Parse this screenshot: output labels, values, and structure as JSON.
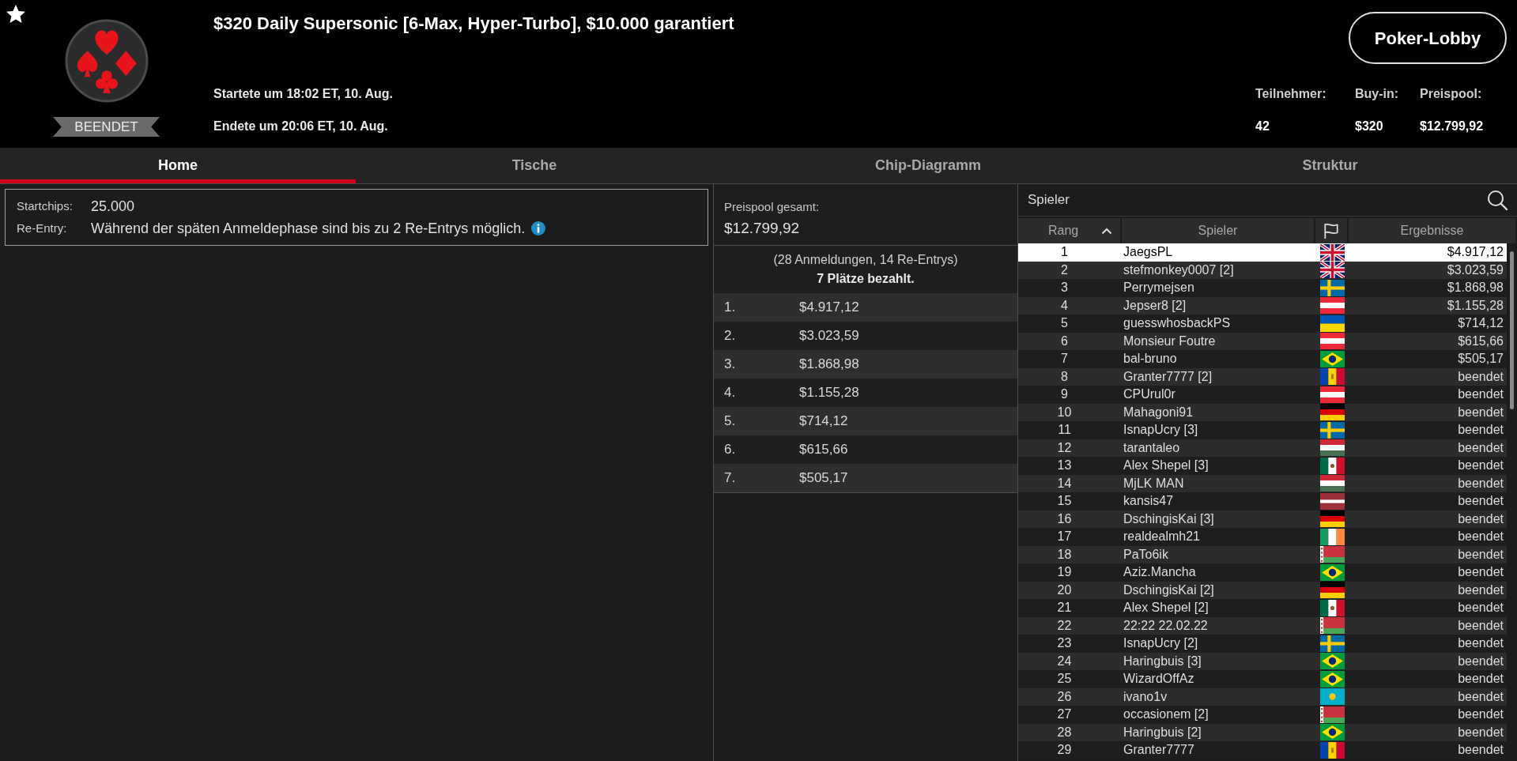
{
  "header": {
    "status": "BEENDET",
    "title": "$320 Daily Supersonic [6-Max, Hyper-Turbo], $10.000 garantiert",
    "started": "Startete um 18:02 ET, 10. Aug.",
    "ended": "Endete um 20:06 ET, 10. Aug.",
    "lobby_button": "Poker-Lobby",
    "stats": [
      {
        "label": "Teilnehmer:",
        "value": "42"
      },
      {
        "label": "Buy-in:",
        "value": "$320"
      },
      {
        "label": "Preispool:",
        "value": "$12.799,92"
      }
    ]
  },
  "tabs": [
    {
      "label": "Home",
      "selected": true
    },
    {
      "label": "Tische",
      "selected": false
    },
    {
      "label": "Chip-Diagramm",
      "selected": false
    },
    {
      "label": "Struktur",
      "selected": false
    }
  ],
  "info_rows": [
    {
      "label": "Startchips:",
      "value": "25.000",
      "info": false
    },
    {
      "label": "Re-Entry:",
      "value": "Während der späten Anmeldephase sind bis zu 2 Re-Entrys möglich.",
      "info": true
    }
  ],
  "prize_pool": {
    "label": "Preispool gesamt:",
    "total": "$12.799,92",
    "entries": "(28 Anmeldungen, 14 Re-Entrys)",
    "paid": "7 Plätze bezahlt.",
    "payouts": [
      {
        "place": "1.",
        "amount": "$4.917,12"
      },
      {
        "place": "2.",
        "amount": "$3.023,59"
      },
      {
        "place": "3.",
        "amount": "$1.868,98"
      },
      {
        "place": "4.",
        "amount": "$1.155,28"
      },
      {
        "place": "5.",
        "amount": "$714,12"
      },
      {
        "place": "6.",
        "amount": "$615,66"
      },
      {
        "place": "7.",
        "amount": "$505,17"
      }
    ]
  },
  "players": {
    "title": "Spieler",
    "columns": [
      {
        "kind": "text",
        "label": "Rang",
        "sorted": true
      },
      {
        "kind": "text",
        "label": "Spieler",
        "sorted": false
      },
      {
        "kind": "flag",
        "sorted": false
      },
      {
        "kind": "text",
        "label": "Ergebnisse",
        "sorted": false
      }
    ],
    "rows": [
      {
        "rank": "1",
        "name": "JaegsPL",
        "kind": "gb",
        "result": "$4.917,12",
        "selected": true
      },
      {
        "rank": "2",
        "name": "stefmonkey0007 [2]",
        "kind": "gb",
        "result": "$3.023,59",
        "selected": false
      },
      {
        "rank": "3",
        "name": "Perrymejsen",
        "kind": "se",
        "result": "$1.868,98",
        "selected": false
      },
      {
        "rank": "4",
        "name": "Jepser8 [2]",
        "kind": "at",
        "result": "$1.155,28",
        "selected": false
      },
      {
        "rank": "5",
        "name": "guesswhosbackPS",
        "kind": "ua",
        "result": "$714,12",
        "selected": false
      },
      {
        "rank": "6",
        "name": "Monsieur Foutre",
        "kind": "at",
        "result": "$615,66",
        "selected": false
      },
      {
        "rank": "7",
        "name": "bal-bruno",
        "kind": "br",
        "result": "$505,17",
        "selected": false
      },
      {
        "rank": "8",
        "name": "Granter7777 [2]",
        "kind": "md",
        "result": "beendet",
        "selected": false
      },
      {
        "rank": "9",
        "name": "CPUrul0r",
        "kind": "at",
        "result": "beendet",
        "selected": false
      },
      {
        "rank": "10",
        "name": "Mahagoni91",
        "kind": "de",
        "result": "beendet",
        "selected": false
      },
      {
        "rank": "11",
        "name": "IsnapUcry [3]",
        "kind": "se",
        "result": "beendet",
        "selected": false
      },
      {
        "rank": "12",
        "name": "tarantaleo",
        "kind": "hu",
        "result": "beendet",
        "selected": false
      },
      {
        "rank": "13",
        "name": "Alex Shepel [3]",
        "kind": "mx",
        "result": "beendet",
        "selected": false
      },
      {
        "rank": "14",
        "name": "MjLK MAN",
        "kind": "hu",
        "result": "beendet",
        "selected": false
      },
      {
        "rank": "15",
        "name": "kansis47",
        "kind": "lv",
        "result": "beendet",
        "selected": false
      },
      {
        "rank": "16",
        "name": "DschingisKai [3]",
        "kind": "de",
        "result": "beendet",
        "selected": false
      },
      {
        "rank": "17",
        "name": "realdealmh21",
        "kind": "ie",
        "result": "beendet",
        "selected": false
      },
      {
        "rank": "18",
        "name": "PaTo6ik",
        "kind": "by",
        "result": "beendet",
        "selected": false
      },
      {
        "rank": "19",
        "name": "Aziz.Mancha",
        "kind": "br",
        "result": "beendet",
        "selected": false
      },
      {
        "rank": "20",
        "name": "DschingisKai [2]",
        "kind": "de",
        "result": "beendet",
        "selected": false
      },
      {
        "rank": "21",
        "name": "Alex Shepel [2]",
        "kind": "mx",
        "result": "beendet",
        "selected": false
      },
      {
        "rank": "22",
        "name": "22:22 22.02.22",
        "kind": "by",
        "result": "beendet",
        "selected": false
      },
      {
        "rank": "23",
        "name": "IsnapUcry [2]",
        "kind": "se",
        "result": "beendet",
        "selected": false
      },
      {
        "rank": "24",
        "name": "Haringbuis [3]",
        "kind": "br",
        "result": "beendet",
        "selected": false
      },
      {
        "rank": "25",
        "name": "WizardOffAz",
        "kind": "br",
        "result": "beendet",
        "selected": false
      },
      {
        "rank": "26",
        "name": "ivano1v",
        "kind": "kz",
        "result": "beendet",
        "selected": false
      },
      {
        "rank": "27",
        "name": "occasionem [2]",
        "kind": "by",
        "result": "beendet",
        "selected": false
      },
      {
        "rank": "28",
        "name": "Haringbuis [2]",
        "kind": "br",
        "result": "beendet",
        "selected": false
      },
      {
        "rank": "29",
        "name": "Granter7777",
        "kind": "md",
        "result": "beendet",
        "selected": false
      }
    ]
  }
}
